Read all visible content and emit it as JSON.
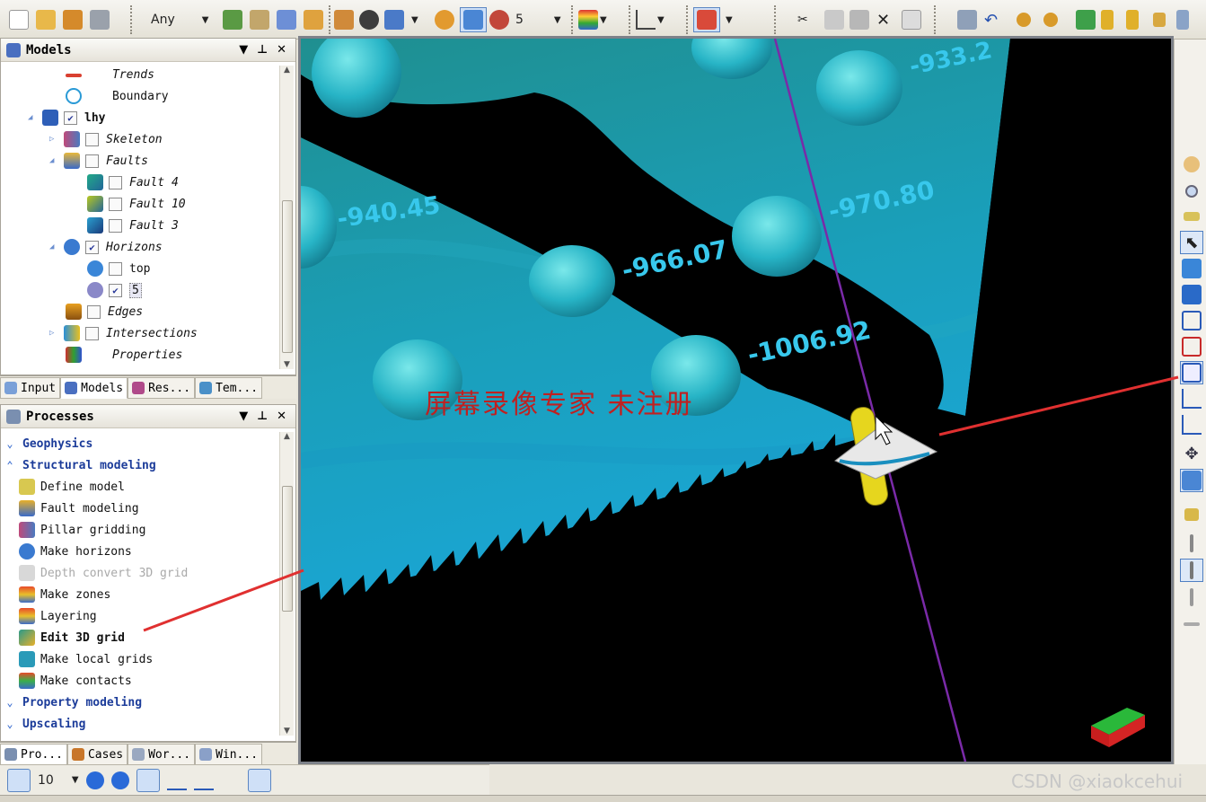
{
  "toolbar": {
    "filter_value": "Any",
    "number_value": "5"
  },
  "models_panel": {
    "title": "Models",
    "tree": [
      {
        "label": "Trends",
        "checked": null
      },
      {
        "label": "Boundary",
        "checked": null
      },
      {
        "label": "lhy",
        "checked": true
      },
      {
        "label": "Skeleton",
        "checked": false
      },
      {
        "label": "Faults",
        "checked": false
      },
      {
        "label": "Fault 4",
        "checked": false
      },
      {
        "label": "Fault 10",
        "checked": false
      },
      {
        "label": "Fault 3",
        "checked": false
      },
      {
        "label": "Horizons",
        "checked": true
      },
      {
        "label": "top",
        "checked": false
      },
      {
        "label": "5",
        "checked": true
      },
      {
        "label": "Edges",
        "checked": false
      },
      {
        "label": "Intersections",
        "checked": false
      },
      {
        "label": "Properties",
        "checked": null
      }
    ],
    "tabs": [
      "Input",
      "Models",
      "Res...",
      "Tem..."
    ]
  },
  "processes_panel": {
    "title": "Processes",
    "items": [
      {
        "label": "Geophysics",
        "type": "head",
        "expanded": false
      },
      {
        "label": "Structural modeling",
        "type": "head",
        "expanded": true
      },
      {
        "label": "Define model",
        "type": "item"
      },
      {
        "label": "Fault modeling",
        "type": "item"
      },
      {
        "label": "Pillar gridding",
        "type": "item"
      },
      {
        "label": "Make horizons",
        "type": "item"
      },
      {
        "label": "Depth convert 3D grid",
        "type": "disabled"
      },
      {
        "label": "Make zones",
        "type": "item"
      },
      {
        "label": "Layering",
        "type": "item"
      },
      {
        "label": "Edit 3D grid",
        "type": "current"
      },
      {
        "label": "Make local grids",
        "type": "item"
      },
      {
        "label": "Make contacts",
        "type": "item"
      },
      {
        "label": "Property modeling",
        "type": "head",
        "expanded": false
      },
      {
        "label": "Upscaling",
        "type": "head",
        "expanded": false
      }
    ],
    "tabs": [
      "Pro...",
      "Cases",
      "Wor...",
      "Win..."
    ]
  },
  "bottombar": {
    "count_value": "10"
  },
  "viewport": {
    "contour_labels": [
      "-940.45",
      "-970.80",
      "-966.07",
      "-1006.92",
      "-933.2"
    ],
    "overlay_text": "屏幕录像专家 未注册"
  },
  "watermark": "CSDN @xiaokcehui",
  "colors": {
    "surface_top": "#1f8f90",
    "surface_bottom": "#1aa6d6",
    "label_color": "#38c8ec",
    "overlay_red": "#c02020",
    "selection_blue": "#4f7fc2"
  }
}
